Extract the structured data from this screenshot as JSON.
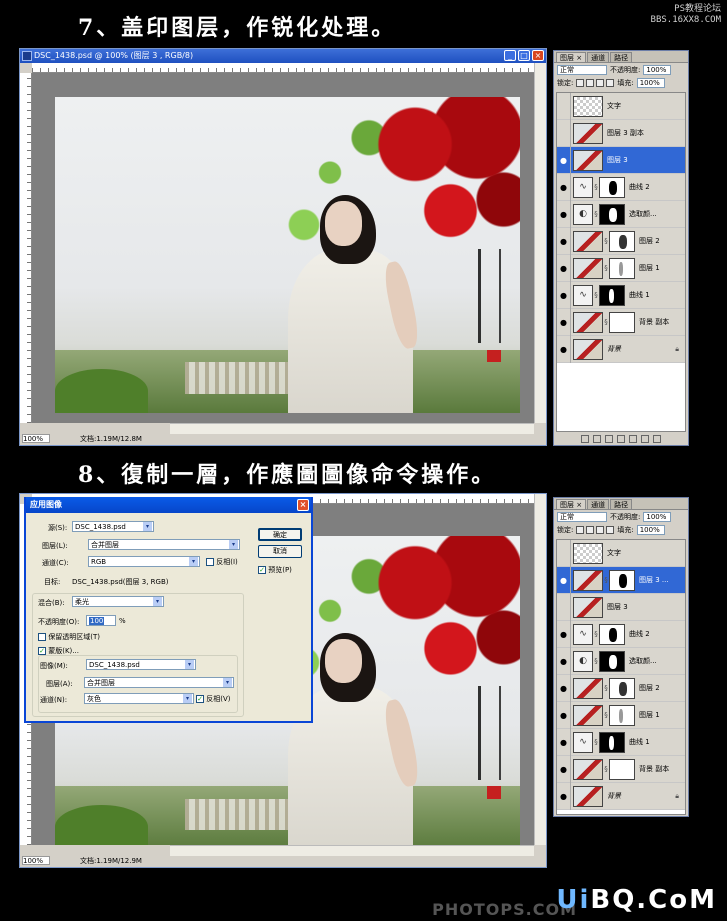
{
  "steps": {
    "step7": "7、盖印图层，作锐化处理。",
    "step8": "8、復制一層，作應圖圖像命令操作。"
  },
  "watermark_top": {
    "line1": "PS教程论坛",
    "line2": "BBS.16XX8.COM"
  },
  "watermark_bottom": {
    "brand_a": "Ui",
    "brand_b": "BQ.CoM",
    "sub": "PHOTOPS.COM"
  },
  "doc1": {
    "title": "DSC_1438.psd @ 100% (图层 3 , RGB/8)",
    "zoom": "100%",
    "docinfo": "文档:1.19M/12.8M"
  },
  "doc2": {
    "zoom": "100%",
    "docinfo": "文档:1.19M/12.9M"
  },
  "panel1": {
    "tabs": [
      "图层 ×",
      "通道",
      "路径"
    ],
    "blend_mode": "正常",
    "opacity_label": "不透明度:",
    "opacity_value": "100%",
    "lock_label": "锁定:",
    "fill_label": "填充:",
    "fill_value": "100%",
    "layers": [
      {
        "name": "文字",
        "visible": false
      },
      {
        "name": "图层 3 副本",
        "visible": false
      },
      {
        "name": "图层 3",
        "visible": true
      },
      {
        "name": "曲线 2",
        "visible": true
      },
      {
        "name": "选取颜...",
        "visible": true
      },
      {
        "name": "图层 2",
        "visible": true
      },
      {
        "name": "图层 1",
        "visible": true
      },
      {
        "name": "曲线 1",
        "visible": true
      },
      {
        "name": "背景 副本",
        "visible": true
      },
      {
        "name": "背景",
        "visible": true
      }
    ]
  },
  "panel2": {
    "tabs": [
      "图层 ×",
      "通道",
      "路径"
    ],
    "blend_mode": "正常",
    "opacity_label": "不透明度:",
    "opacity_value": "100%",
    "lock_label": "锁定:",
    "fill_label": "填充:",
    "fill_value": "100%",
    "layers": [
      {
        "name": "文字",
        "visible": false
      },
      {
        "name": "图层 3 ...",
        "visible": true
      },
      {
        "name": "图层 3",
        "visible": false
      },
      {
        "name": "曲线 2",
        "visible": true
      },
      {
        "name": "选取颜...",
        "visible": true
      },
      {
        "name": "图层 2",
        "visible": true
      },
      {
        "name": "图层 1",
        "visible": true
      },
      {
        "name": "曲线 1",
        "visible": true
      },
      {
        "name": "背景 副本",
        "visible": true
      },
      {
        "name": "背景",
        "visible": true
      }
    ]
  },
  "dialog": {
    "title": "应用图像",
    "source_label": "源(S):",
    "source_value": "DSC_1438.psd",
    "layer_label": "图层(L):",
    "layer_value": "合并图层",
    "channel_label": "通道(C):",
    "channel_value": "RGB",
    "invert_label": "反相(I)",
    "target_label": "目标:",
    "target_value": "DSC_1438.psd(图层 3, RGB)",
    "blending_label": "混合(B):",
    "blending_value": "柔光",
    "opacity_label": "不透明度(O):",
    "opacity_value": "100",
    "opacity_unit": "%",
    "preserve_label": "保留透明区域(T)",
    "mask_label": "蒙版(K)...",
    "image_label": "图像(M):",
    "image_value": "DSC_1438.psd",
    "mask_layer_label": "图层(A):",
    "mask_layer_value": "合并图层",
    "mask_channel_label": "通道(N):",
    "mask_channel_value": "灰色",
    "mask_invert_label": "反相(V)",
    "ok_label": "确定",
    "cancel_label": "取消",
    "preview_label": "预览(P)"
  }
}
